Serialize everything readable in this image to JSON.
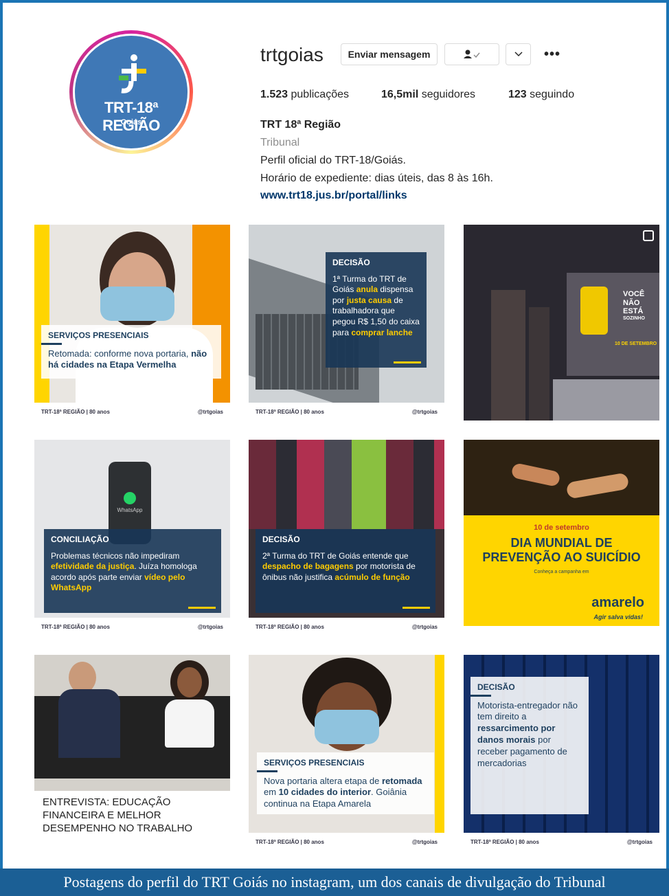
{
  "profile": {
    "avatar_org": "TRT-18ª REGIÃO",
    "avatar_state": "Goiás",
    "username": "trtgoias",
    "message_button": "Enviar mensagem",
    "follow_icon": "person-check-icon",
    "dropdown_icon": "chevron-down-icon",
    "more_icon": "•••",
    "posts_count": "1.523",
    "posts_label": "publicações",
    "followers_count": "16,5mil",
    "followers_label": "seguidores",
    "following_count": "123",
    "following_label": "seguindo",
    "full_name": "TRT 18ª Região",
    "category": "Tribunal",
    "bio_line1": "Perfil oficial do TRT-18/Goiás.",
    "bio_line2": "Horário de expediente: dias úteis, das 8 às 16h.",
    "website": "www.trt18.jus.br/portal/links"
  },
  "footer_left": "TRT-18ª REGIÃO | 80 anos",
  "footer_right": "@trtgoias",
  "posts": [
    {
      "tag": "SERVIÇOS PRESENCIAIS",
      "text_a": "Retomada: conforme nova portaria, ",
      "text_b": "não há cidades na Etapa Vermelha"
    },
    {
      "tag": "DECISÃO",
      "text_a": "1ª Turma do TRT de Goiás ",
      "hl1": "anula",
      "text_b": " dispensa por ",
      "hl2": "justa causa",
      "text_c": " de trabalhadora que pegou R$ 1,50 do caixa para ",
      "hl3": "comprar lanche"
    },
    {
      "sign_1": "VOCÊ",
      "sign_2": "NÃO",
      "sign_3": "ESTÁ",
      "sign_4": "SOZINHO",
      "sign_date": "10 DE SETEMBRO"
    },
    {
      "tag": "CONCILIAÇÃO",
      "phone_label": "WhatsApp",
      "text_a": "Problemas técnicos não impediram ",
      "hl1": "efetividade da justiça",
      "text_b": ". Juíza homologa acordo após parte enviar ",
      "hl2": "vídeo pelo WhatsApp"
    },
    {
      "tag": "DECISÃO",
      "text_a": "2ª Turma do TRT de Goiás entende que ",
      "hl1": "despacho de bagagens",
      "text_b": " por motorista de ônibus não justifica ",
      "hl2": "acúmulo de função"
    },
    {
      "date": "10 de setembro",
      "title_1": "DIA MUNDIAL DE",
      "title_2": "PREVENÇÃO AO SUICÍDIO",
      "sub": "Conheça a campanha em",
      "brand": "amarelo",
      "slogan": "Agir salva vidas!"
    },
    {
      "title": "ENTREVISTA: EDUCAÇÃO FINANCEIRA E MELHOR DESEMPENHO NO TRABALHO"
    },
    {
      "tag": "SERVIÇOS PRESENCIAIS",
      "text_a": "Nova portaria altera etapa de ",
      "hl1": "retomada",
      "text_b": " em ",
      "hl2": "10 cidades do interior",
      "text_c": ". Goiânia continua na Etapa Amarela"
    },
    {
      "tag": "DECISÃO",
      "text_a": "Motorista-entregador não tem direito a ",
      "hl1": "ressarcimento por danos morais",
      "text_b": " por receber pagamento de mercadorias"
    }
  ],
  "caption": "Postagens do perfil do TRT Goiás no instagram, um dos canais de divulgação do Tribunal"
}
